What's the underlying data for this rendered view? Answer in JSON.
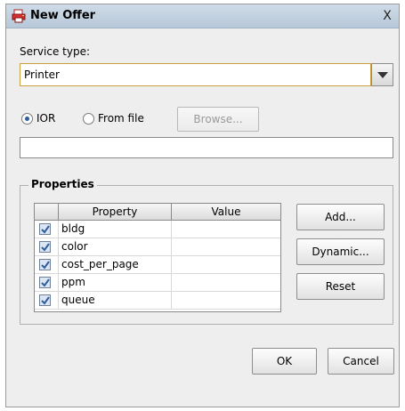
{
  "window": {
    "title": "New Offer",
    "close_glyph": "X"
  },
  "service_type": {
    "label": "Service type:",
    "value": "Printer"
  },
  "source": {
    "ior_label": "IOR",
    "file_label": "From file",
    "browse_label": "Browse...",
    "selected": "IOR",
    "field_value": ""
  },
  "properties": {
    "title": "Properties",
    "columns": [
      "",
      "Property",
      "Value"
    ],
    "rows": [
      {
        "checked": true,
        "property": "bldg",
        "value": ""
      },
      {
        "checked": true,
        "property": "color",
        "value": ""
      },
      {
        "checked": true,
        "property": "cost_per_page",
        "value": ""
      },
      {
        "checked": true,
        "property": "ppm",
        "value": ""
      },
      {
        "checked": true,
        "property": "queue",
        "value": ""
      }
    ],
    "buttons": {
      "add": "Add...",
      "dynamic": "Dynamic...",
      "reset": "Reset"
    }
  },
  "footer": {
    "ok": "OK",
    "cancel": "Cancel"
  },
  "colors": {
    "accent": "#2f5d9e",
    "combo_focus_border": "#c8a040"
  },
  "icons": {
    "title": "printer-app-icon",
    "dropdown": "chevron-down-icon",
    "checkbox": "checkmark-icon"
  }
}
